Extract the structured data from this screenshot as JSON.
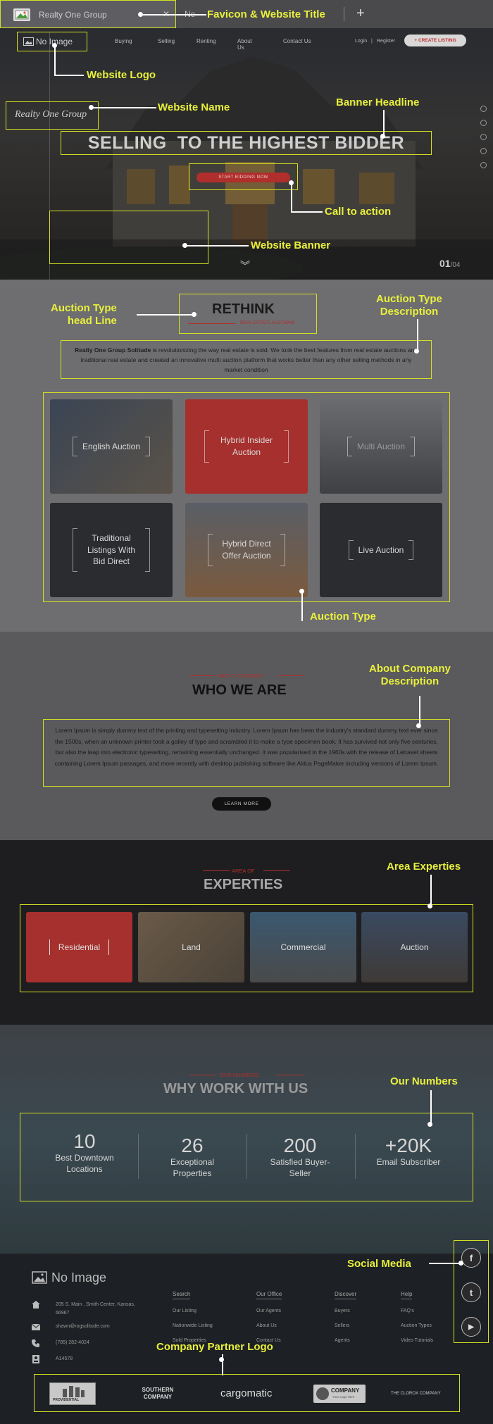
{
  "browser": {
    "tab_title": "Realty One Group",
    "close_glyph": "✕",
    "new_tab_label": "Ne",
    "plus_glyph": "+"
  },
  "header": {
    "logo_text": "No Image",
    "site_name": "Realty One Group",
    "nav": [
      "Buying",
      "Selling",
      "Renting",
      "About Us",
      "Contact Us"
    ],
    "login": "Login",
    "register": "Register",
    "separator": "|",
    "create_listing": "+ CREATE LISTING"
  },
  "hero": {
    "headline": "SELLING  TO THE HIGHEST BIDDER",
    "cta": "START BIDDING NOW",
    "slide_current": "01",
    "slide_total": "/04",
    "chevron": "︾"
  },
  "rethink": {
    "title": "RETHINK",
    "subtitle": "REAL ESTATE AUCTIONS",
    "desc_bold": "Realty One Group Solitude",
    "desc_rest": " is revolutionizing the way real estate is sold. We took the best features from real estate auctions and traditional real estate and created an innovative multi auction platform that works better than any other selling methods in any market condition",
    "cards": [
      "English Auction",
      "Hybrid Insider Auction",
      "Multi Auction",
      "Traditional Listings With Bid Direct",
      "Hybrid Direct Offer Auction",
      "Live Auction"
    ]
  },
  "about": {
    "eyebrow": "ABOUT COMPANY",
    "title": "WHO WE ARE",
    "text": "Lorem Ipsum is simply dummy text of the printing and typesetting industry. Lorem Ipsum has been the industry's standard dummy text ever since the 1500s, when an unknown printer took a galley of type and scrambled it to make a type specimen book. It has survived not only five centuries, but also the leap into electronic typesetting, remaining essentially unchanged. It was popularised in the 1960s with the release of Letraset sheets containing Lorem Ipsum passages, and more recently with desktop publishing software like Aldus PageMaker including versions of Lorem Ipsum.",
    "button": "LEARN MORE"
  },
  "experties": {
    "eyebrow": "AREA OF",
    "title": "EXPERTIES",
    "cards": [
      "Residential",
      "Land",
      "Commercial",
      "Auction"
    ]
  },
  "numbers": {
    "eyebrow": "OUR NUMBERS",
    "title": "WHY WORK WITH US",
    "items": [
      {
        "value": "10",
        "label": "Best Downtown Locations"
      },
      {
        "value": "26",
        "label": "Exceptional Properties"
      },
      {
        "value": "200",
        "label": "Satisfied Buyer-Seller"
      },
      {
        "value": "+20K",
        "label": "Email Subscriber"
      }
    ]
  },
  "footer": {
    "logo_text": "No Image",
    "address": "205 S. Main , Smith Center, Kansas, 66967",
    "email": "shawn@rogsolitude.com",
    "phone": "(785) 282-4024",
    "license": "A14578",
    "columns": [
      {
        "head": "Search",
        "links": [
          "Our Listing",
          "Nationwide Listing",
          "Sold Properties"
        ]
      },
      {
        "head": "Our Office",
        "links": [
          "Our Agents",
          "About Us",
          "Contact Us"
        ]
      },
      {
        "head": "Discover",
        "links": [
          "Buyers",
          "Sellers",
          "Agents"
        ]
      },
      {
        "head": "Help",
        "links": [
          "FAQ's",
          "Auction Types",
          "Video Tutorials"
        ]
      }
    ],
    "partners": [
      "PROVIDENTIAL",
      "SOUTHERN COMPANY",
      "cargomatic",
      "COMPANY",
      "THE CLOROX COMPANY"
    ],
    "partner_sub": [
      "",
      "",
      "",
      "Your Logo Here",
      ""
    ]
  },
  "social": [
    "f",
    "t",
    "▶"
  ],
  "annotations": {
    "favicon_title": "Favicon & Website Title",
    "logo": "Website Logo",
    "name": "Website Name",
    "banner_headline": "Banner Headline",
    "cta": "Call to action",
    "banner": "Website Banner",
    "auction_head": "Auction Type\nhead Line",
    "auction_desc": "Auction Type\nDescription",
    "auction_type": "Auction Type",
    "about_desc": "About Company\nDescription",
    "area_exp": "Area Experties",
    "our_numbers": "Our Numbers",
    "social": "Social Media",
    "partner_logo": "Company Partner Logo"
  },
  "colors": {
    "annotation": "#e8f03c",
    "accent_red": "#c0302d",
    "box": "#d4e023"
  }
}
